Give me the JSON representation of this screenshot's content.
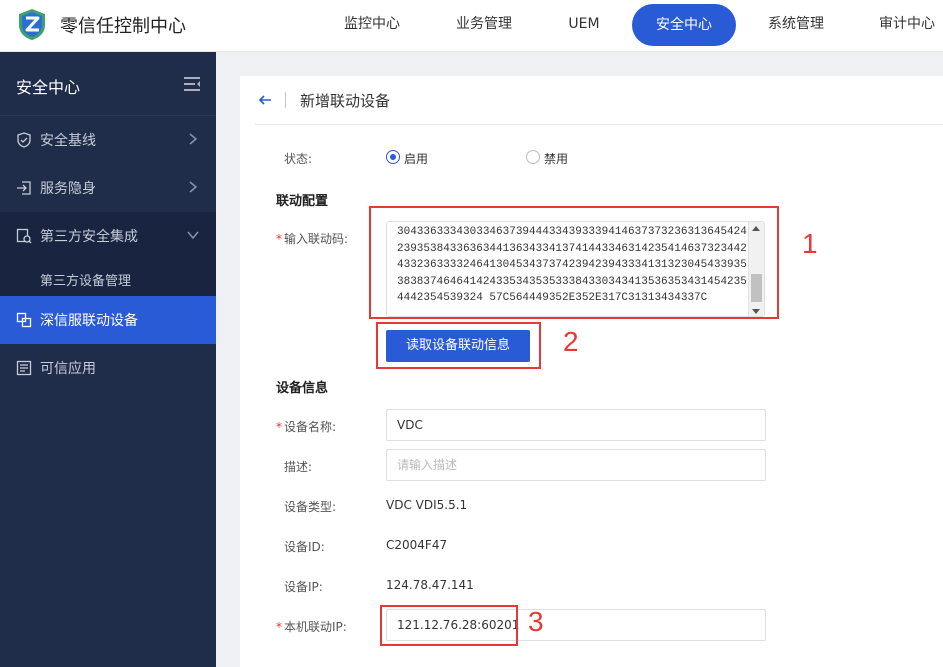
{
  "app": {
    "title": "零信任控制中心"
  },
  "nav": {
    "items": [
      "监控中心",
      "业务管理",
      "UEM",
      "安全中心",
      "系统管理",
      "审计中心"
    ],
    "active": "安全中心"
  },
  "sidebar": {
    "title": "安全中心",
    "items": [
      {
        "label": "安全基线",
        "icon": "shield-icon"
      },
      {
        "label": "服务隐身",
        "icon": "login-icon"
      },
      {
        "label": "第三方安全集成",
        "icon": "integration-icon"
      },
      {
        "label": "深信服联动设备",
        "icon": "link-icon"
      },
      {
        "label": "可信应用",
        "icon": "app-list-icon"
      }
    ],
    "sub_item": "第三方设备管理"
  },
  "page": {
    "title": "新增联动设备",
    "status_label": "状态:",
    "status_on": "启用",
    "status_off": "禁用",
    "linkage_section": "联动配置",
    "linkage_code_label": "输入联动码:",
    "linkage_code": "304336333430334637394443343933394146373732363136454242393538433636344136343341374144334631423541463732344243323633332464130453437374239423943334131323045433935383837464641424335343535333843303434135363534314542354442354539324 57C564449352E352E317C31313434337C",
    "read_button": "读取设备联动信息",
    "device_section": "设备信息",
    "device_name_label": "设备名称:",
    "device_name_value": "VDC",
    "desc_label": "描述:",
    "desc_placeholder": "请输入描述",
    "device_type_label": "设备类型:",
    "device_type_value": "VDC VDI5.5.1",
    "device_id_label": "设备ID:",
    "device_id_value": "C2004F47",
    "device_ip_label": "设备IP:",
    "device_ip_value": "124.78.47.141",
    "local_ip_label": "本机联动IP:",
    "local_ip_value": "121.12.76.28:60201"
  },
  "annotations": {
    "n1": "1",
    "n2": "2",
    "n3": "3"
  },
  "colors": {
    "primary": "#2a5bd7",
    "sidebar": "#1f2d4a",
    "annotation": "#e53935"
  }
}
